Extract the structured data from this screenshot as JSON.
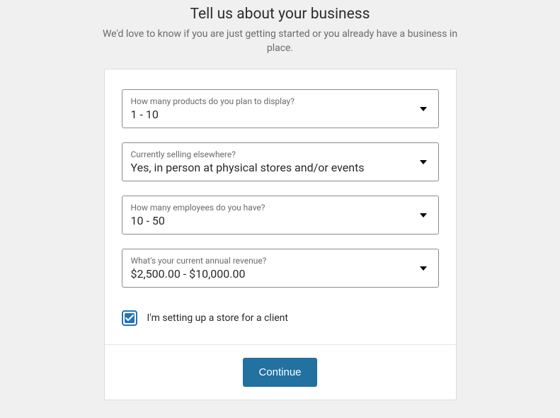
{
  "header": {
    "title": "Tell us about your business",
    "subtitle": "We'd love to know if you are just getting started or you already have a business in place."
  },
  "fields": {
    "products": {
      "label": "How many products do you plan to display?",
      "value": "1 - 10"
    },
    "selling": {
      "label": "Currently selling elsewhere?",
      "value": "Yes, in person at physical stores and/or events"
    },
    "employees": {
      "label": "How many employees do you have?",
      "value": "10 - 50"
    },
    "revenue": {
      "label": "What's your current annual revenue?",
      "value": "$2,500.00 - $10,000.00"
    }
  },
  "checkbox": {
    "label": "I'm setting up a store for a client",
    "checked": true
  },
  "footer": {
    "continue": "Continue"
  }
}
